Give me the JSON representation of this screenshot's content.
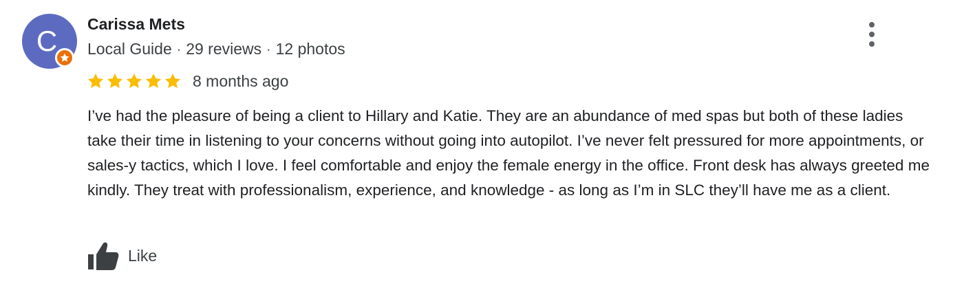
{
  "review": {
    "author": {
      "initial": "C",
      "name": "Carissa Mets",
      "badge_icon": "local-guide-star-icon",
      "avatar_color": "#5c6bc0",
      "badge_color": "#e8710a",
      "meta": {
        "level": "Local Guide",
        "separator": "·",
        "reviews": "29 reviews",
        "photos": "12 photos"
      }
    },
    "rating": 5,
    "max_rating": 5,
    "star_color": "#fbbc04",
    "date": "8 months ago",
    "text": "I’ve had the pleasure of being a client to Hillary and Katie. They are an abundance of med spas but both of these ladies take their time in listening to your concerns without going into autopilot. I’ve never felt pressured for more appointments, or sales-y tactics, which I love. I feel comfortable and enjoy the female energy in the office. Front desk has always greeted me kindly. They treat with professionalism, experience, and knowledge - as long as I’m in SLC they’ll have me as a client.",
    "actions": {
      "more_icon": "more-vert-icon",
      "like_icon": "thumbs-up-icon",
      "like_label": "Like"
    }
  }
}
